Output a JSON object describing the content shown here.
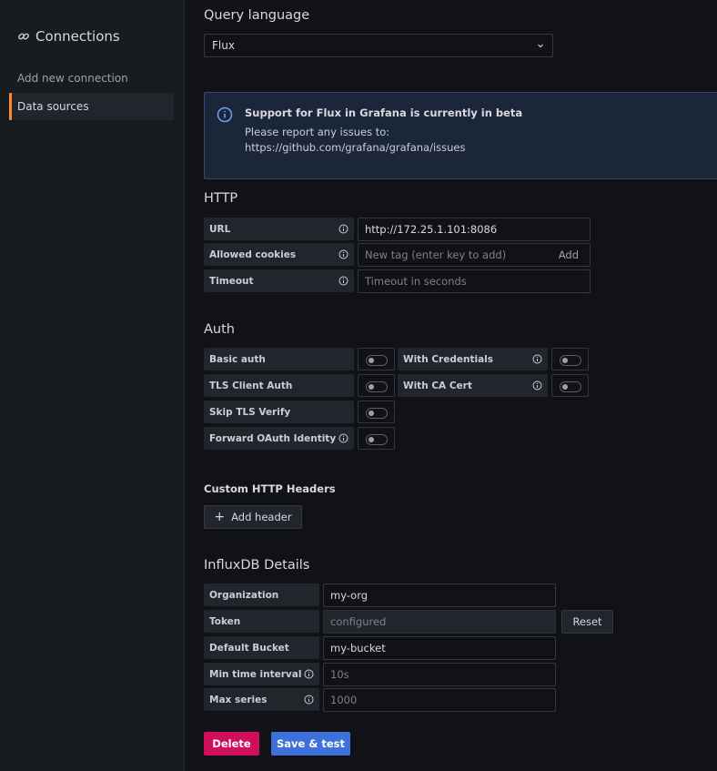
{
  "sidebar": {
    "title": "Connections",
    "items": [
      {
        "label": "Add new connection"
      },
      {
        "label": "Data sources"
      }
    ]
  },
  "query_language": {
    "heading": "Query language",
    "selected": "Flux"
  },
  "alert": {
    "title": "Support for Flux in Grafana is currently in beta",
    "line1": "Please report any issues to:",
    "line2": "https://github.com/grafana/grafana/issues"
  },
  "http": {
    "heading": "HTTP",
    "url_label": "URL",
    "url_value": "http://172.25.1.101:8086",
    "cookies_label": "Allowed cookies",
    "cookies_placeholder": "New tag (enter key to add)",
    "cookies_add": "Add",
    "timeout_label": "Timeout",
    "timeout_placeholder": "Timeout in seconds"
  },
  "auth": {
    "heading": "Auth",
    "basic_auth": "Basic auth",
    "with_credentials": "With Credentials",
    "tls_client_auth": "TLS Client Auth",
    "with_ca_cert": "With CA Cert",
    "skip_tls_verify": "Skip TLS Verify",
    "forward_oauth": "Forward OAuth Identity"
  },
  "custom_headers": {
    "heading": "Custom HTTP Headers",
    "add_label": "Add header"
  },
  "influx": {
    "heading": "InfluxDB Details",
    "org_label": "Organization",
    "org_value": "my-org",
    "token_label": "Token",
    "token_value": "configured",
    "token_reset": "Reset",
    "bucket_label": "Default Bucket",
    "bucket_value": "my-bucket",
    "min_interval_label": "Min time interval",
    "min_interval_placeholder": "10s",
    "max_series_label": "Max series",
    "max_series_placeholder": "1000"
  },
  "actions": {
    "delete": "Delete",
    "save_test": "Save & test"
  },
  "colors": {
    "background": "#111217",
    "sidebar": "#181b1f",
    "accent_orange": "#ff8833",
    "danger": "#d10e5c",
    "primary": "#3d71d9",
    "info_blue": "#6e9fff"
  }
}
